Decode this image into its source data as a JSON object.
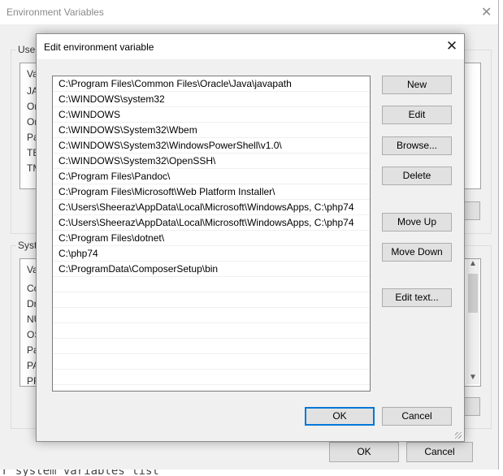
{
  "background_window": {
    "title": "Environment Variables",
    "user_group_label": "User",
    "user_list_header": "Va",
    "user_list_items": [
      "JA",
      "On",
      "On",
      "Pa",
      "TE",
      "TM"
    ],
    "system_group_label": "Syste",
    "system_list_header": "Va",
    "system_list_items": [
      "Co",
      "Dr",
      "NU",
      "OS",
      "Pa",
      "PA",
      "PR"
    ],
    "ok_label": "OK",
    "cancel_label": "Cancel",
    "bottom_text": "r system variables list"
  },
  "dialog": {
    "title": "Edit environment variable",
    "close_glyph": "✕",
    "paths": [
      "C:\\Program Files\\Common Files\\Oracle\\Java\\javapath",
      "C:\\WINDOWS\\system32",
      "C:\\WINDOWS",
      "C:\\WINDOWS\\System32\\Wbem",
      "C:\\WINDOWS\\System32\\WindowsPowerShell\\v1.0\\",
      "C:\\WINDOWS\\System32\\OpenSSH\\",
      "C:\\Program Files\\Pandoc\\",
      "C:\\Program Files\\Microsoft\\Web Platform Installer\\",
      "C:\\Users\\Sheeraz\\AppData\\Local\\Microsoft\\WindowsApps, C:\\php74",
      "C:\\Users\\Sheeraz\\AppData\\Local\\Microsoft\\WindowsApps, C:\\php74",
      "C:\\Program Files\\dotnet\\",
      "C:\\php74",
      "C:\\ProgramData\\ComposerSetup\\bin",
      "",
      "",
      "",
      "",
      "",
      "",
      "",
      ""
    ],
    "buttons": {
      "new": "New",
      "edit": "Edit",
      "browse": "Browse...",
      "delete": "Delete",
      "move_up": "Move Up",
      "move_down": "Move Down",
      "edit_text": "Edit text...",
      "ok": "OK",
      "cancel": "Cancel"
    }
  }
}
